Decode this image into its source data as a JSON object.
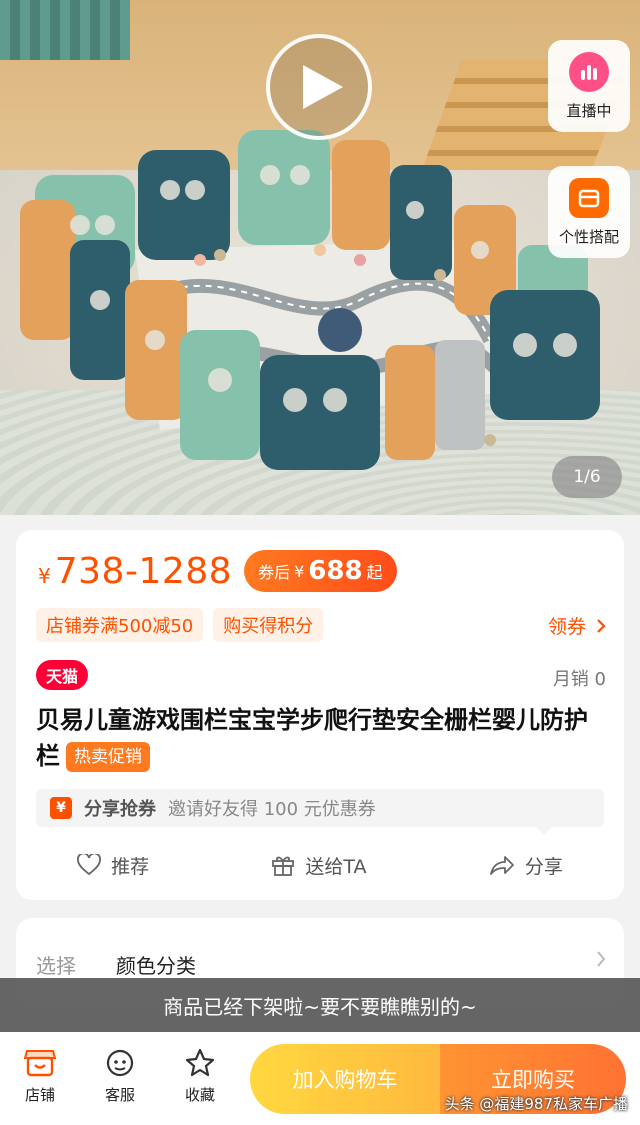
{
  "media": {
    "live_label": "直播中",
    "style_label": "个性搭配",
    "counter": "1/6"
  },
  "price": {
    "currency": "¥",
    "range": "738-1288",
    "after_coupon_prefix": "券后",
    "after_coupon_currency": "¥",
    "after_coupon_value": "688",
    "after_coupon_suffix": "起"
  },
  "tags": [
    "店铺券满500减50",
    "购买得积分"
  ],
  "coupon_link": "领券",
  "store_badge": "天猫",
  "monthly_sales": "月销 0",
  "title": "贝易儿童游戏围栏宝宝学步爬行垫安全栅栏婴儿防护栏",
  "title_badge": "热卖促销",
  "share_promo": {
    "icon_text": "¥",
    "label": "分享抢券",
    "text": "邀请好友得 100 元优惠券"
  },
  "actions": {
    "recommend": "推荐",
    "gift": "送给TA",
    "share": "分享"
  },
  "select": {
    "label": "选择",
    "value": "颜色分类"
  },
  "toast": "商品已经下架啦~要不要瞧瞧别的~",
  "bottom_nav": {
    "store": "店铺",
    "service": "客服",
    "favorite": "收藏",
    "add_to_cart": "加入购物车",
    "buy_now": "立即购买"
  },
  "watermark": "头条 @福建987私家车广播",
  "colors": {
    "accent": "#ff5000",
    "tmall": "#ff0036",
    "cart": "#ffa200",
    "buy": "#ff4f00"
  }
}
